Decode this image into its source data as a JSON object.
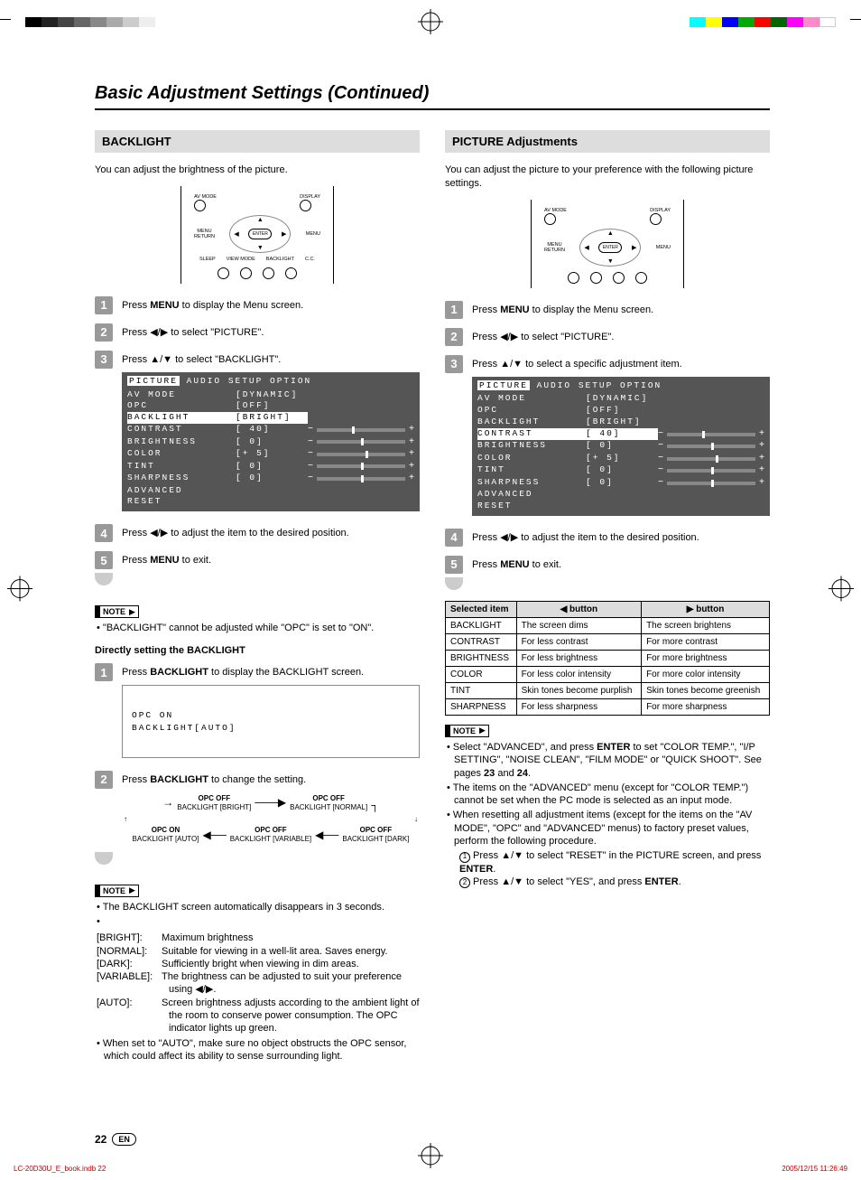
{
  "page": {
    "title": "Basic Adjustment Settings (Continued)",
    "number": "22",
    "lang_badge": "EN"
  },
  "remote": {
    "top_left": "AV MODE",
    "top_right": "DISPLAY",
    "left": "MENU\nRETURN",
    "right": "MENU",
    "enter": "ENTER",
    "bottom_labels": [
      "SLEEP",
      "VIEW MODE",
      "BACKLIGHT",
      "C.C."
    ]
  },
  "left": {
    "heading": "BACKLIGHT",
    "intro": "You can adjust the brightness of the picture.",
    "steps": {
      "s1": "Press MENU to display the Menu screen.",
      "s2": "Press ◀/▶ to select \"PICTURE\".",
      "s3": "Press ▲/▼ to select \"BACKLIGHT\".",
      "s4": "Press ◀/▶ to adjust the item to the desired position.",
      "s5": "Press MENU to exit."
    },
    "osd": {
      "tabs": [
        "PICTURE",
        "AUDIO",
        "SETUP",
        "OPTION"
      ],
      "rows": [
        {
          "label": "AV MODE",
          "value": "[DYNAMIC]",
          "slider": false,
          "sel": false
        },
        {
          "label": "OPC",
          "value": "[OFF]",
          "slider": false,
          "sel": false
        },
        {
          "label": "BACKLIGHT",
          "value": "[BRIGHT]",
          "slider": false,
          "sel": true
        },
        {
          "label": "CONTRAST",
          "value": "[  40]",
          "slider": true,
          "knob": 40,
          "sel": false
        },
        {
          "label": "BRIGHTNESS",
          "value": "[   0]",
          "slider": true,
          "knob": 50,
          "sel": false
        },
        {
          "label": "COLOR",
          "value": "[+  5]",
          "slider": true,
          "knob": 55,
          "sel": false
        },
        {
          "label": "TINT",
          "value": "[   0]",
          "slider": true,
          "knob": 50,
          "sel": false
        },
        {
          "label": "SHARPNESS",
          "value": "[   0]",
          "slider": true,
          "knob": 50,
          "sel": false
        },
        {
          "label": "ADVANCED",
          "value": "",
          "slider": false,
          "sel": false
        },
        {
          "label": "RESET",
          "value": "",
          "slider": false,
          "sel": false
        }
      ]
    },
    "note1": "\"BACKLIGHT\" cannot be adjusted while \"OPC\" is set to \"ON\".",
    "direct_heading": "Directly setting the BACKLIGHT",
    "direct_steps": {
      "s1": "Press BACKLIGHT to display the BACKLIGHT screen.",
      "s2": "Press BACKLIGHT to change the setting."
    },
    "osd_mini": {
      "line1": "OPC ON",
      "line2": "BACKLIGHT[AUTO]"
    },
    "flow": {
      "top": [
        {
          "t1": "OPC OFF",
          "t2": "BACKLIGHT [BRIGHT]"
        },
        {
          "t1": "OPC OFF",
          "t2": "BACKLIGHT [NORMAL]"
        }
      ],
      "bottom": [
        {
          "t1": "OPC ON",
          "t2": "BACKLIGHT [AUTO]"
        },
        {
          "t1": "OPC OFF",
          "t2": "BACKLIGHT [VARIABLE]"
        },
        {
          "t1": "OPC OFF",
          "t2": "BACKLIGHT [DARK]"
        }
      ]
    },
    "notes2": {
      "n1": "The BACKLIGHT screen automatically disappears in 3 seconds.",
      "defs": [
        {
          "label": "[BRIGHT]:",
          "text": "Maximum brightness"
        },
        {
          "label": "[NORMAL]:",
          "text": "Suitable for viewing in a well-lit area. Saves energy."
        },
        {
          "label": "[DARK]:",
          "text": "Sufficiently bright when viewing in dim areas."
        },
        {
          "label": "[VARIABLE]:",
          "text": "The brightness can be adjusted to suit your preference using ◀/▶."
        },
        {
          "label": "[AUTO]:",
          "text": "Screen brightness adjusts according to the ambient light of the room to conserve power consumption. The OPC indicator lights up green."
        }
      ],
      "n3": "When set to \"AUTO\", make sure no object obstructs the OPC sensor, which could affect its ability to sense surrounding light."
    }
  },
  "right": {
    "heading": "PICTURE Adjustments",
    "intro": "You can adjust the picture to your preference with the following picture settings.",
    "steps": {
      "s1": "Press MENU to display the Menu screen.",
      "s2": "Press ◀/▶ to select \"PICTURE\".",
      "s3": "Press ▲/▼ to select a specific adjustment item.",
      "s4": "Press ◀/▶ to adjust the item to the desired position.",
      "s5": "Press MENU to exit."
    },
    "osd": {
      "tabs": [
        "PICTURE",
        "AUDIO",
        "SETUP",
        "OPTION"
      ],
      "rows": [
        {
          "label": "AV MODE",
          "value": "[DYNAMIC]",
          "slider": false,
          "sel": false
        },
        {
          "label": "OPC",
          "value": "[OFF]",
          "slider": false,
          "sel": false
        },
        {
          "label": "BACKLIGHT",
          "value": "[BRIGHT]",
          "slider": false,
          "sel": false
        },
        {
          "label": "CONTRAST",
          "value": "[  40]",
          "slider": true,
          "knob": 40,
          "sel": true
        },
        {
          "label": "BRIGHTNESS",
          "value": "[   0]",
          "slider": true,
          "knob": 50,
          "sel": false
        },
        {
          "label": "COLOR",
          "value": "[+  5]",
          "slider": true,
          "knob": 55,
          "sel": false
        },
        {
          "label": "TINT",
          "value": "[   0]",
          "slider": true,
          "knob": 50,
          "sel": false
        },
        {
          "label": "SHARPNESS",
          "value": "[   0]",
          "slider": true,
          "knob": 50,
          "sel": false
        },
        {
          "label": "ADVANCED",
          "value": "",
          "slider": false,
          "sel": false
        },
        {
          "label": "RESET",
          "value": "",
          "slider": false,
          "sel": false
        }
      ]
    },
    "table": {
      "headers": [
        "Selected item",
        "◀ button",
        "▶ button"
      ],
      "rows": [
        [
          "BACKLIGHT",
          "The screen dims",
          "The screen brightens"
        ],
        [
          "CONTRAST",
          "For less contrast",
          "For more contrast"
        ],
        [
          "BRIGHTNESS",
          "For less brightness",
          "For more brightness"
        ],
        [
          "COLOR",
          "For less color intensity",
          "For more color intensity"
        ],
        [
          "TINT",
          "Skin tones become purplish",
          "Skin tones become greenish"
        ],
        [
          "SHARPNESS",
          "For less sharpness",
          "For more sharpness"
        ]
      ]
    },
    "notes": {
      "n1": "Select \"ADVANCED\", and press ENTER to set \"COLOR TEMP.\", \"I/P SETTING\", \"NOISE CLEAN\", \"FILM MODE\" or \"QUICK SHOOT\". See pages 23 and 24.",
      "n2": "The items on the \"ADVANCED\" menu (except for \"COLOR TEMP.\") cannot be set when the PC mode is selected as an input mode.",
      "n3": "When resetting all adjustment items (except for the items on the \"AV MODE\", \"OPC\" and \"ADVANCED\" menus) to factory preset values, perform the following procedure.",
      "sub1": "Press ▲/▼ to select \"RESET\" in the PICTURE screen, and press ENTER.",
      "sub2": "Press ▲/▼ to select \"YES\", and press ENTER."
    }
  },
  "footer": {
    "file": "LC-20D30U_E_book.indb   22",
    "stamp": "2005/12/15   11:26:49"
  },
  "note_label": "NOTE"
}
